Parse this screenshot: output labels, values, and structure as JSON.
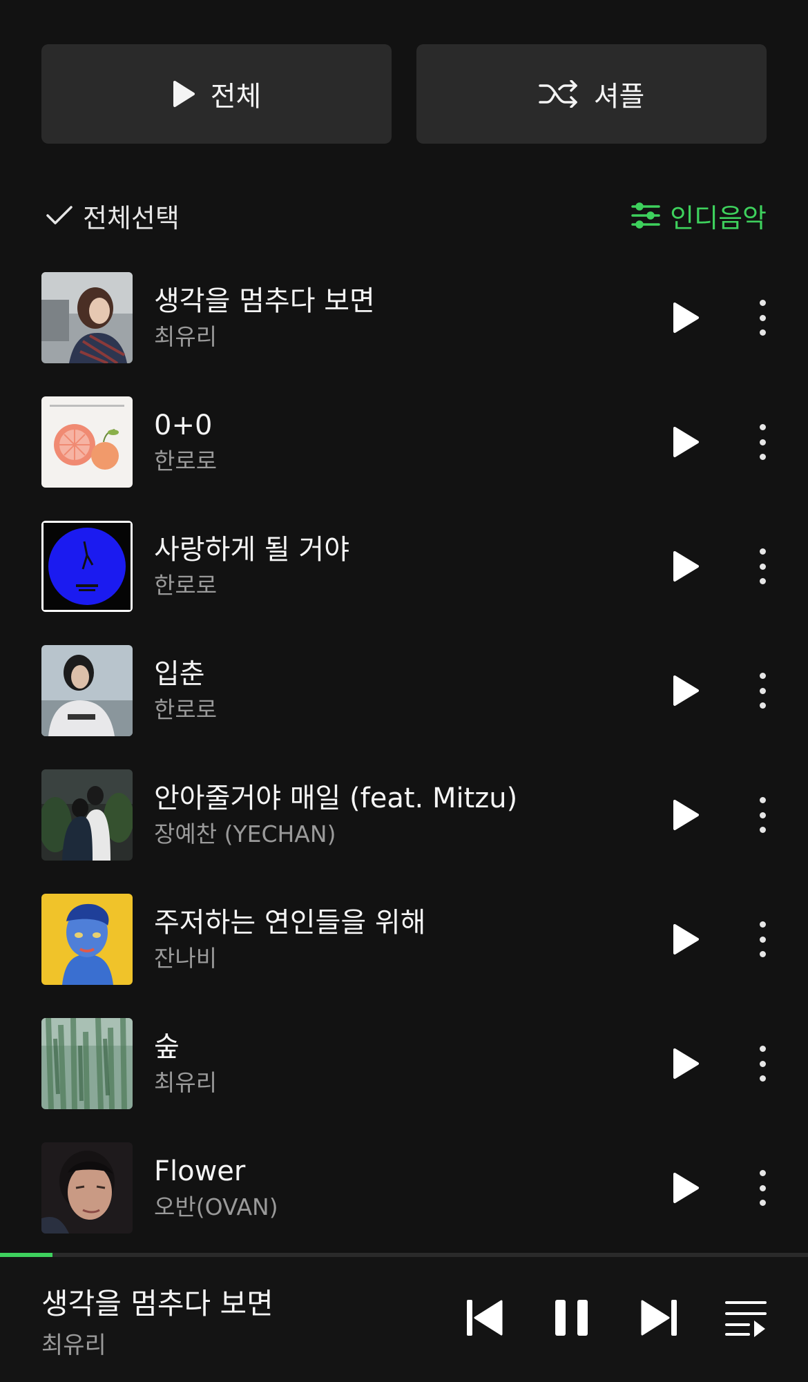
{
  "buttons": {
    "play_all": "전체",
    "shuffle": "셔플"
  },
  "list_header": {
    "select_all": "전체선택",
    "filter": "인디음악"
  },
  "tracks": [
    {
      "title": "생각을 멈추다 보면",
      "artist": "최유리"
    },
    {
      "title": "0+0",
      "artist": "한로로"
    },
    {
      "title": "사랑하게 될 거야",
      "artist": "한로로"
    },
    {
      "title": "입춘",
      "artist": "한로로"
    },
    {
      "title": "안아줄거야 매일 (feat. Mitzu)",
      "artist": "장예찬 (YECHAN)"
    },
    {
      "title": "주저하는 연인들을 위해",
      "artist": "잔나비"
    },
    {
      "title": "숲",
      "artist": "최유리"
    },
    {
      "title": "Flower",
      "artist": "오반(OVAN)"
    }
  ],
  "now_playing": {
    "title": "생각을 멈추다 보면",
    "artist": "최유리",
    "progress": 0.065
  },
  "colors": {
    "accent": "#3ed15d",
    "background": "#121212",
    "button": "#2a2a2a"
  }
}
